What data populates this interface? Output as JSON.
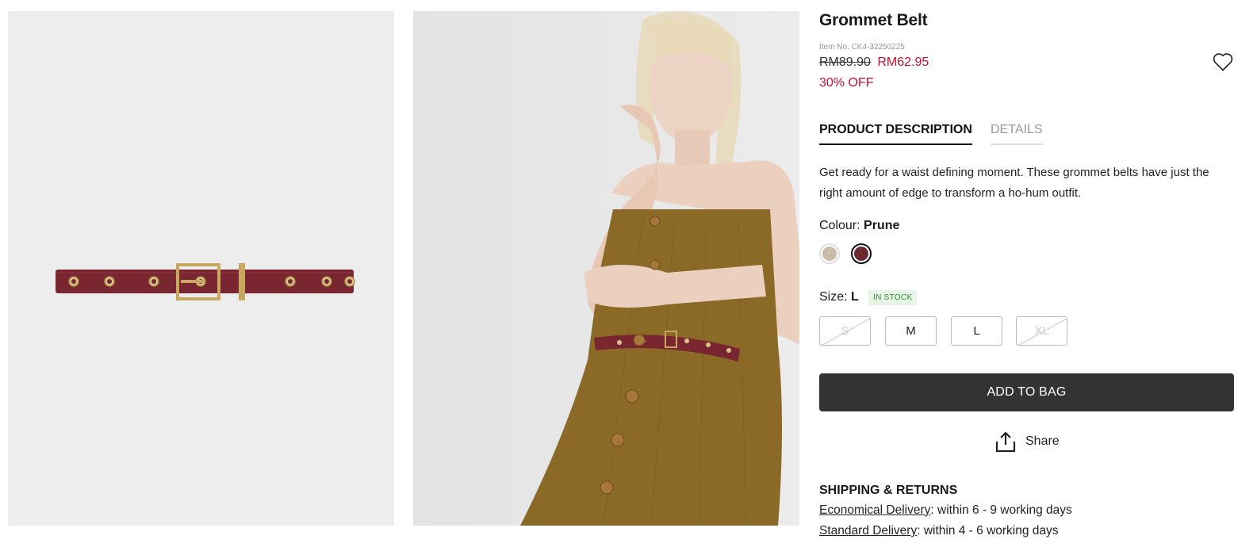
{
  "product": {
    "title": "Grommet Belt",
    "item_no": "Item No. CK4-32250225",
    "old_price": "RM89.90",
    "new_price": "RM62.95",
    "discount": "30% OFF"
  },
  "tabs": {
    "description_label": "PRODUCT DESCRIPTION",
    "details_label": "DETAILS"
  },
  "description": "Get ready for a waist defining moment. These grommet belts have just the right amount of edge to transform a ho-hum outfit.",
  "colour": {
    "label": "Colour:",
    "selected": "Prune",
    "swatches": [
      {
        "color": "#c9bca8"
      },
      {
        "color": "#6b2a30"
      }
    ]
  },
  "size": {
    "label": "Size:",
    "selected": "L",
    "stock": "IN STOCK",
    "options": [
      {
        "label": "S",
        "available": false
      },
      {
        "label": "M",
        "available": true
      },
      {
        "label": "L",
        "available": true
      },
      {
        "label": "XL",
        "available": false
      }
    ]
  },
  "actions": {
    "add_to_bag": "ADD TO BAG",
    "share": "Share"
  },
  "shipping": {
    "title": "SHIPPING & RETURNS",
    "lines": [
      {
        "link": "Economical Delivery",
        "text": ": within 6 - 9 working days"
      },
      {
        "link": "Standard Delivery",
        "text": ": within 4 - 6 working days"
      }
    ]
  },
  "colors": {
    "sale_red": "#c8102e",
    "button_dark": "#333333",
    "belt": "#7a2630",
    "dress": "#8b6a28"
  }
}
